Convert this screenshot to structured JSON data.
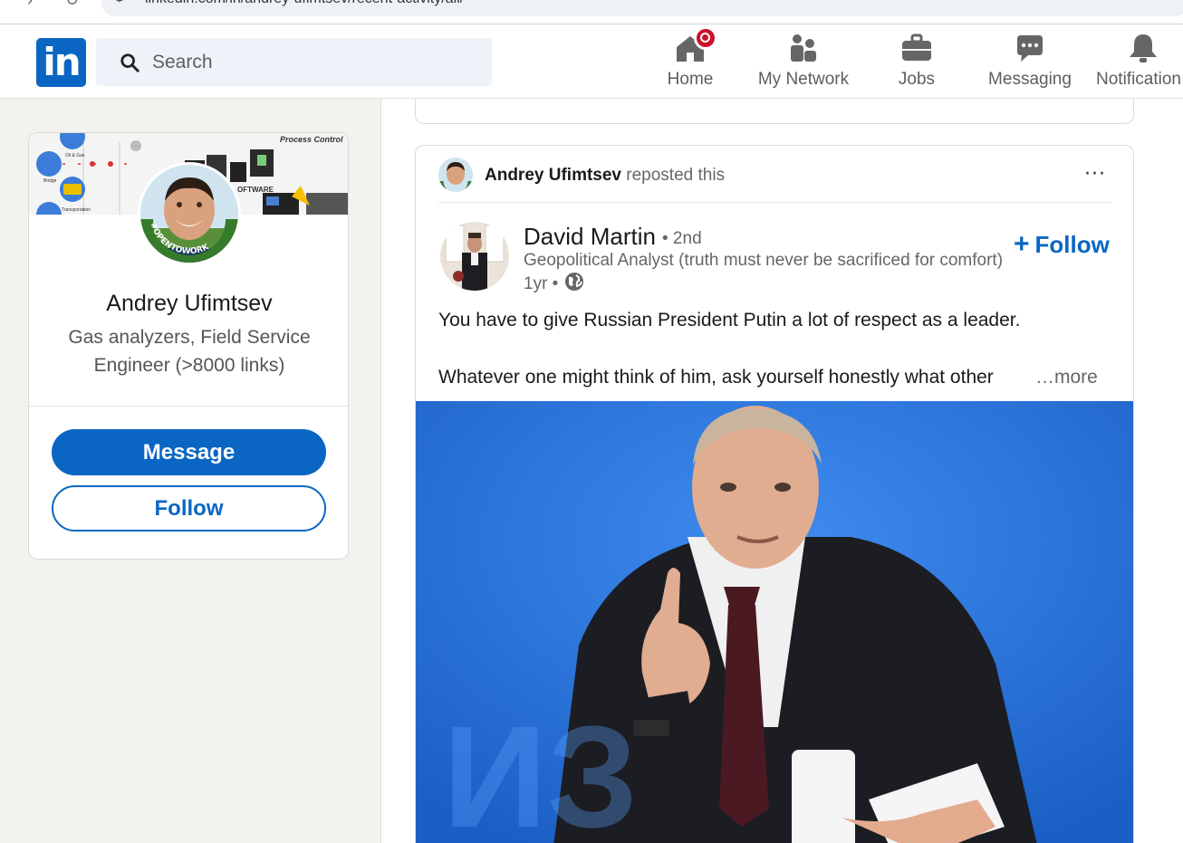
{
  "browser": {
    "url": "linkedin.com/in/andrey-ufimtsev/recent-activity/all/",
    "back_glyph": "›",
    "reload_glyph": "↻",
    "site_icon_glyph": "⚙"
  },
  "header": {
    "logo_text": "in",
    "search": {
      "placeholder": "Search",
      "value": ""
    },
    "nav": [
      {
        "label": "Home",
        "icon": "home-icon",
        "has_notification_badge": true
      },
      {
        "label": "My Network",
        "icon": "people-icon"
      },
      {
        "label": "Jobs",
        "icon": "briefcase-icon"
      },
      {
        "label": "Messaging",
        "icon": "chat-bubble-icon"
      },
      {
        "label": "Notification",
        "icon": "bell-icon"
      }
    ],
    "brand_color": "#0a66c2",
    "badge_color": "#cb112d"
  },
  "profile": {
    "name": "Andrey Ufimtsev",
    "headline": "Gas analyzers, Field Service Engineer (>8000 links)",
    "open_to_work_frame": "#OPENTOWORK",
    "banner_labels": [
      "Process Control",
      "Oil & Gas",
      "Bridge",
      "Transportation",
      "OFTWARE"
    ],
    "message_button": "Message",
    "follow_button": "Follow"
  },
  "post": {
    "reposter_name": "Andrey Ufimtsev",
    "repost_text": "reposted this",
    "more_menu": "···",
    "author": {
      "name": "David Martin",
      "degree": "• 2nd",
      "headline": "Geopolitical Analyst (truth must never be sacrificed for comfort)",
      "time": "1yr •",
      "visibility_icon": "globe-icon"
    },
    "follow_button": "Follow",
    "follow_plus": "+",
    "text_line1": "You have to give Russian President Putin a lot of respect as a leader.",
    "text_line2": "Whatever one might think of him, ask yourself honestly what other",
    "see_more": "…more",
    "image_backdrop": "ИЗ"
  }
}
